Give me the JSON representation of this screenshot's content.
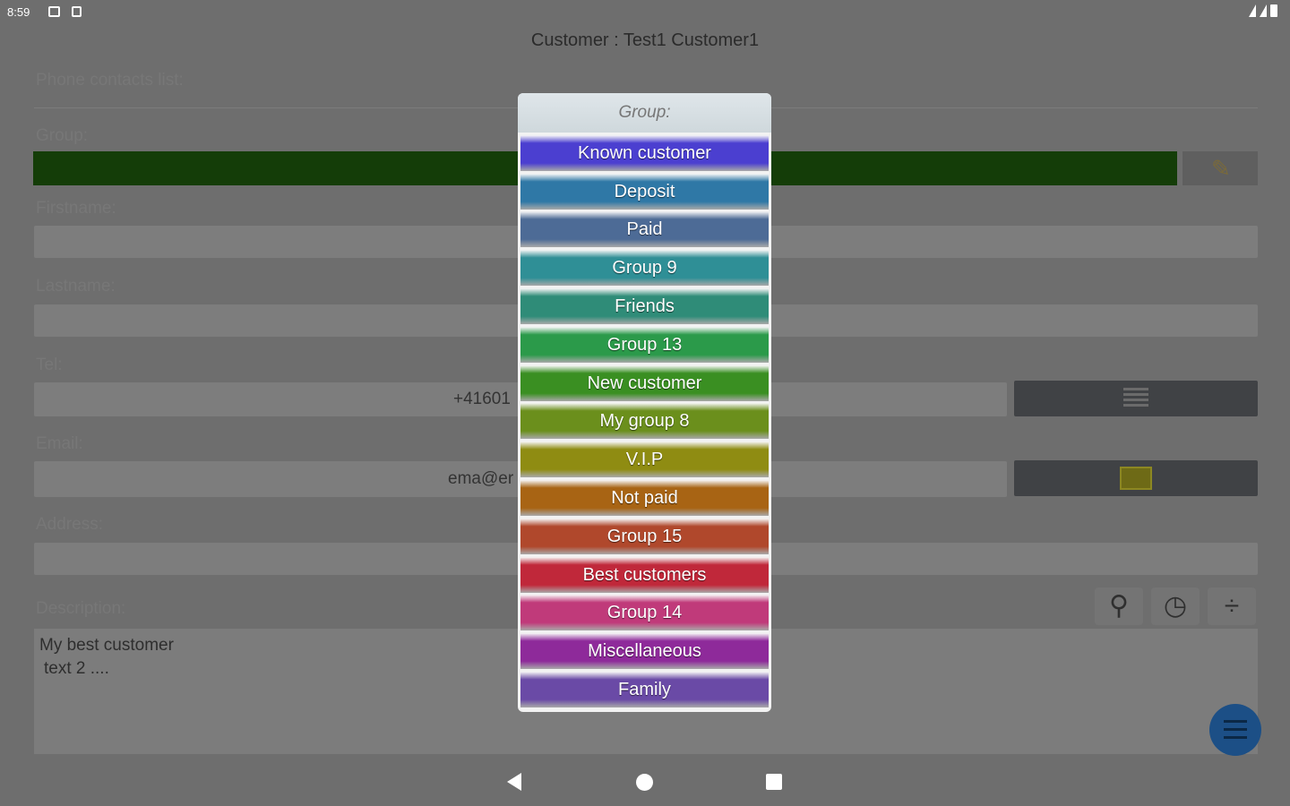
{
  "status_bar": {
    "time": "8:59"
  },
  "window_title": "Customer : Test1 Customer1",
  "form": {
    "phone_contacts_label": "Phone contacts list:",
    "group_label": "Group:",
    "firstname_label": "Firstname:",
    "lastname_label": "Lastname:",
    "tel_label": "Tel:",
    "tel_value": "+41601",
    "email_label": "Email:",
    "email_value": "ema@er",
    "address_label": "Address:",
    "description_label": "Description:",
    "description_lines": [
      "My best customer",
      "text 2 ...."
    ]
  },
  "dialog": {
    "title": "Group:",
    "options": [
      {
        "label": "Known customer",
        "color": "#4b3fd0"
      },
      {
        "label": "Deposit",
        "color": "#2f78a6"
      },
      {
        "label": "Paid",
        "color": "#4d6b96"
      },
      {
        "label": "Group 9",
        "color": "#2f8f96"
      },
      {
        "label": "Friends",
        "color": "#2f8c78"
      },
      {
        "label": "Group 13",
        "color": "#2b9a4a"
      },
      {
        "label": "New customer",
        "color": "#3a8f22"
      },
      {
        "label": "My group 8",
        "color": "#6b8f1c"
      },
      {
        "label": "V.I.P",
        "color": "#8f8c12"
      },
      {
        "label": "Not paid",
        "color": "#a86414"
      },
      {
        "label": "Group 15",
        "color": "#b0482c"
      },
      {
        "label": "Best customers",
        "color": "#c0283a"
      },
      {
        "label": "Group 14",
        "color": "#c03a7a"
      },
      {
        "label": "Miscellaneous",
        "color": "#8e2a9a"
      },
      {
        "label": "Family",
        "color": "#6a4aa6"
      }
    ]
  },
  "icons": {
    "edit": "pencil-icon",
    "contacts": "list-icon",
    "email": "envelope-icon",
    "search": "magnifier-icon",
    "timer": "stopwatch-icon",
    "split": "split-icon",
    "menu": "menu-icon"
  }
}
